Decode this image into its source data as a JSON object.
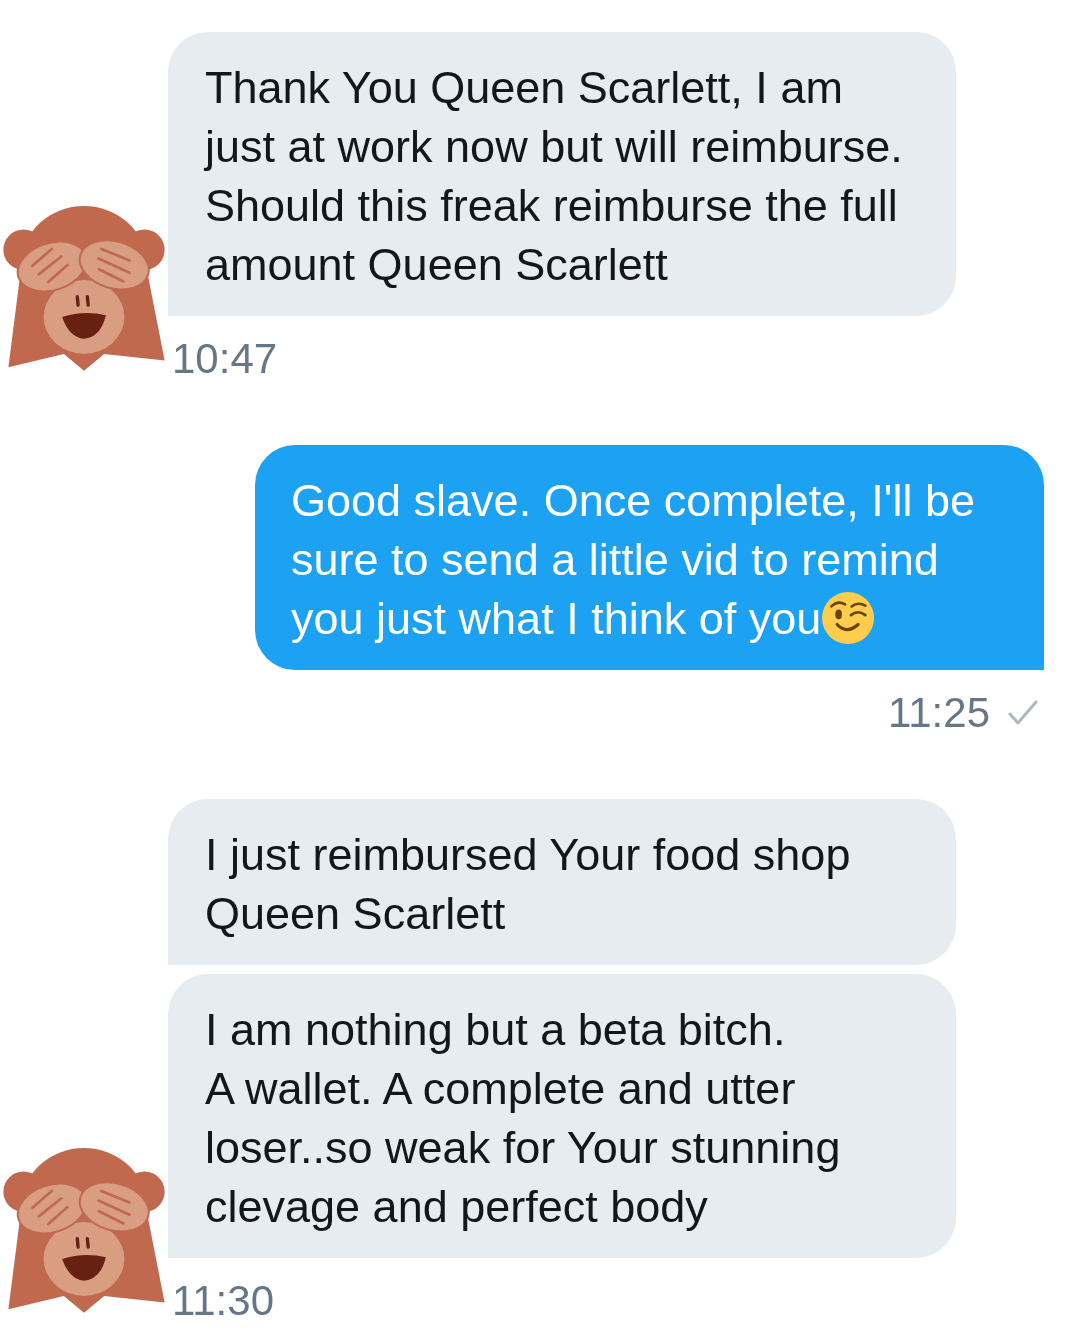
{
  "messages": [
    {
      "kind": "received",
      "avatar": true,
      "bubbles": [
        {
          "kind": "plain",
          "text": "Thank You Queen Scarlett, I am just at work now but will reimburse. Should this freak reimburse the full amount Queen Scarlett"
        }
      ],
      "time": "10:47"
    },
    {
      "kind": "sent",
      "bubbles": [
        {
          "kind": "wink",
          "text": "Good slave. Once complete, I'll be sure to send a little vid to remind you just what I think of you"
        }
      ],
      "time": "11:25",
      "checkmark": true
    },
    {
      "kind": "received",
      "avatar": true,
      "bubbles": [
        {
          "kind": "plain",
          "text": "I just reimbursed Your food shop Queen Scarlett"
        },
        {
          "kind": "plain",
          "text": "I am nothing but a beta bitch.\nA wallet. A complete and utter loser..so weak for Your stunning clevage and perfect body"
        }
      ],
      "time": "11:30"
    }
  ]
}
